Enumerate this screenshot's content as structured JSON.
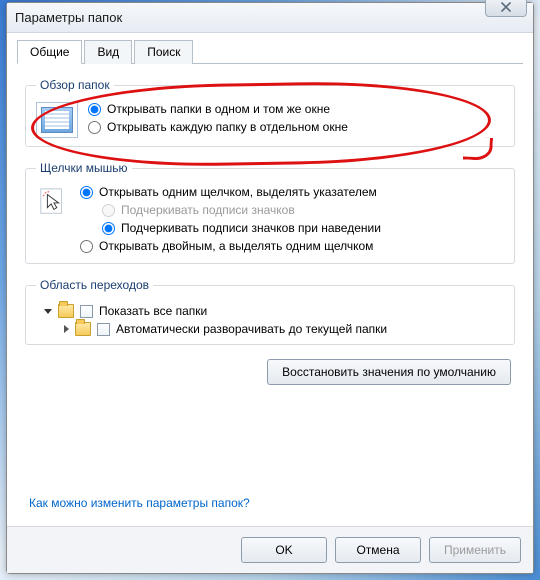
{
  "window": {
    "title": "Параметры папок"
  },
  "tabs": {
    "general": "Общие",
    "view": "Вид",
    "search": "Поиск"
  },
  "groups": {
    "browse": {
      "legend": "Обзор папок",
      "opt1": "Открывать папки в одном и том же окне",
      "opt2": "Открывать каждую папку в отдельном окне"
    },
    "click": {
      "legend": "Щелчки мышью",
      "opt1": "Открывать одним щелчком, выделять указателем",
      "opt1a": "Подчеркивать подписи значков",
      "opt1b": "Подчеркивать подписи значков при наведении",
      "opt2": "Открывать двойным, а выделять одним щелчком"
    },
    "navpane": {
      "legend": "Область переходов",
      "chk1": "Показать все папки",
      "chk2": "Автоматически разворачивать до текущей папки"
    }
  },
  "buttons": {
    "restore": "Восстановить значения по умолчанию",
    "ok": "OK",
    "cancel": "Отмена",
    "apply": "Применить"
  },
  "link": {
    "help": "Как можно изменить параметры папок?"
  },
  "icons": {
    "close": "close-icon",
    "browse": "window-icon",
    "click": "cursor-icon",
    "folder": "folder-icon",
    "expand": "triangle-icon"
  }
}
